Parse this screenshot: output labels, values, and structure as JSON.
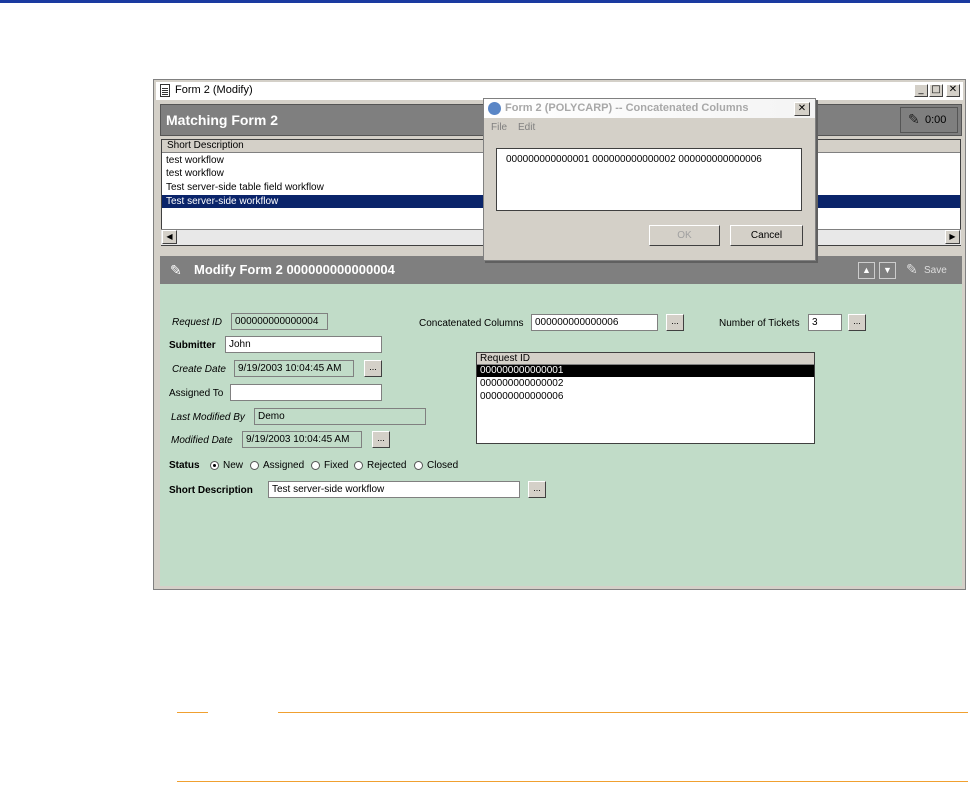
{
  "window": {
    "title": "Form 2 (Modify)",
    "minimize": "_",
    "maximize": "□",
    "close": "✕"
  },
  "results": {
    "header": "Matching Form 2",
    "timer": "0:00",
    "column": "Short Description",
    "rows": [
      "test workflow",
      "test workflow",
      "Test server-side table field workflow",
      "Test server-side workflow"
    ],
    "selected_index": 3
  },
  "dialog": {
    "title": "Form 2 (POLYCARP) -- Concatenated Columns",
    "menu": [
      "File",
      "Edit"
    ],
    "content": "000000000000001  000000000000002  000000000000006",
    "ok": "OK",
    "cancel": "Cancel"
  },
  "modify": {
    "title": "Modify Form 2 000000000000004",
    "save": "Save"
  },
  "form": {
    "request_id_label": "Request ID",
    "request_id": "000000000000004",
    "submitter_label": "Submitter",
    "submitter": "John",
    "create_date_label": "Create Date",
    "create_date": "9/19/2003 10:04:45 AM",
    "assigned_to_label": "Assigned To",
    "assigned_to": "",
    "last_modified_by_label": "Last Modified By",
    "last_modified_by": "Demo",
    "modified_date_label": "Modified Date",
    "modified_date": "9/19/2003 10:04:45 AM",
    "concat_label": "Concatenated Columns",
    "concat_value": "000000000000006",
    "tickets_label": "Number of Tickets",
    "tickets_value": "3",
    "status_label": "Status",
    "status_options": [
      "New",
      "Assigned",
      "Fixed",
      "Rejected",
      "Closed"
    ],
    "status_selected": "New",
    "short_desc_label": "Short Description",
    "short_desc": "Test server-side workflow",
    "ellipsis": "...",
    "table_header": "Request ID",
    "table_rows": [
      "000000000000001",
      "000000000000002",
      "000000000000006"
    ]
  },
  "colors": {
    "form_bg": "#c1dcc8",
    "header_gray": "#7f7f7f",
    "selection": "#0a246a",
    "note_rule": "#f0a030"
  }
}
